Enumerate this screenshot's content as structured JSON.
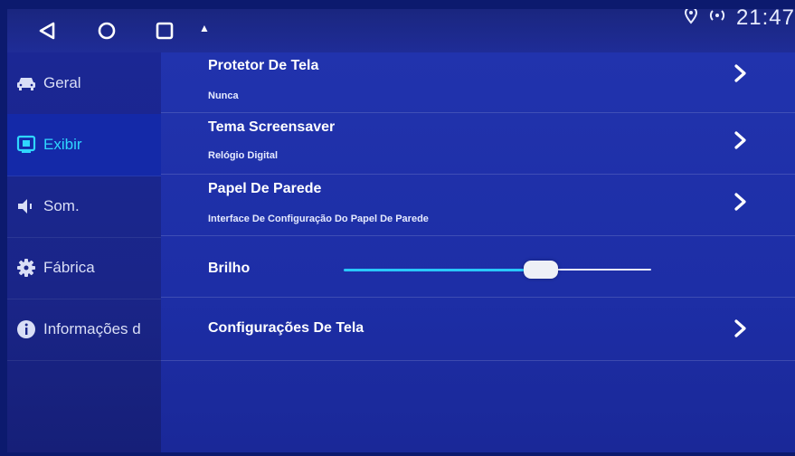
{
  "status": {
    "time": "21:47",
    "alert": "▲"
  },
  "sidebar": {
    "items": [
      {
        "label": "Geral",
        "icon": "car-icon",
        "active": false
      },
      {
        "label": "Exibir",
        "icon": "display-icon",
        "active": true
      },
      {
        "label": "Som.",
        "icon": "speaker-icon",
        "active": false
      },
      {
        "label": "Fábrica",
        "icon": "gear-icon",
        "active": false
      },
      {
        "label": "Informações d",
        "icon": "info-icon",
        "active": false
      }
    ]
  },
  "settings": {
    "screensaver": {
      "title": "Protetor De Tela",
      "value": "Nunca"
    },
    "screensaver_theme": {
      "title": "Tema Screensaver",
      "value": "Relógio Digital"
    },
    "wallpaper": {
      "title": "Papel De Parede",
      "value": "Interface De Configuração Do Papel De Parede"
    },
    "brightness": {
      "title": "Brilho",
      "level": 0.64
    },
    "display_settings": {
      "title": "Configurações De Tela"
    }
  },
  "colors": {
    "accent": "#2fd6ff",
    "slider_active": "#29c8ff",
    "background": "#1d2ea6"
  }
}
